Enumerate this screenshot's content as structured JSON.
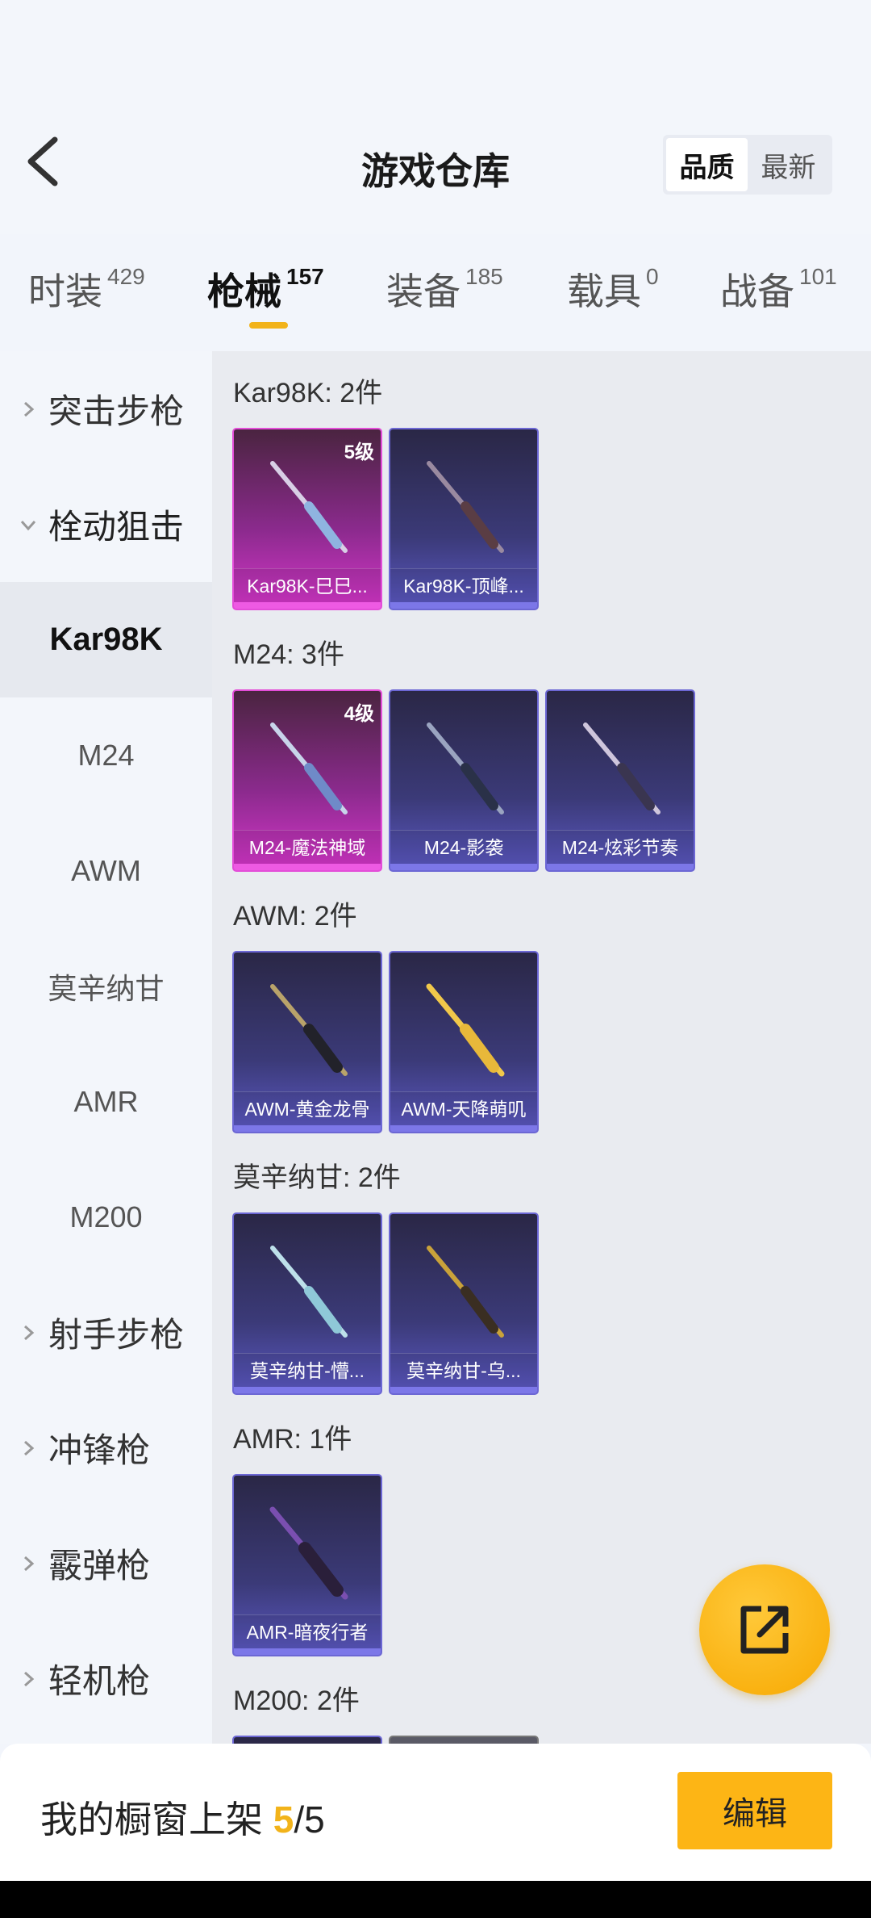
{
  "header": {
    "title": "游戏仓库",
    "sort": [
      {
        "label": "品质",
        "active": true
      },
      {
        "label": "最新",
        "active": false
      }
    ]
  },
  "tabs": [
    {
      "label": "时装",
      "count": "429",
      "active": false
    },
    {
      "label": "枪械",
      "count": "157",
      "active": true
    },
    {
      "label": "装备",
      "count": "185",
      "active": false
    },
    {
      "label": "载具",
      "count": "0",
      "active": false
    },
    {
      "label": "战备",
      "count": "101",
      "active": false
    }
  ],
  "sidebar": {
    "items": [
      {
        "label": "突击步枪",
        "type": "group",
        "expanded": false
      },
      {
        "label": "栓动狙击",
        "type": "group",
        "expanded": true
      },
      {
        "label": "Kar98K",
        "type": "sub",
        "active": true
      },
      {
        "label": "M24",
        "type": "sub",
        "active": false
      },
      {
        "label": "AWM",
        "type": "sub",
        "active": false
      },
      {
        "label": "莫辛纳甘",
        "type": "sub",
        "active": false
      },
      {
        "label": "AMR",
        "type": "sub",
        "active": false
      },
      {
        "label": "M200",
        "type": "sub",
        "active": false
      },
      {
        "label": "射手步枪",
        "type": "group",
        "expanded": false
      },
      {
        "label": "冲锋枪",
        "type": "group",
        "expanded": false
      },
      {
        "label": "霰弹枪",
        "type": "group",
        "expanded": false
      },
      {
        "label": "轻机枪",
        "type": "group",
        "expanded": false
      }
    ]
  },
  "sections": [
    {
      "title": "Kar98K: 2件",
      "items": [
        {
          "name": "Kar98K-巳巳...",
          "level": "5级",
          "quality": "pink"
        },
        {
          "name": "Kar98K-顶峰...",
          "level": "",
          "quality": "purple"
        }
      ]
    },
    {
      "title": "M24: 3件",
      "items": [
        {
          "name": "M24-魔法神域",
          "level": "4级",
          "quality": "pink"
        },
        {
          "name": "M24-影袭",
          "level": "",
          "quality": "purple"
        },
        {
          "name": "M24-炫彩节奏",
          "level": "",
          "quality": "purple"
        }
      ]
    },
    {
      "title": "AWM: 2件",
      "items": [
        {
          "name": "AWM-黄金龙骨",
          "level": "",
          "quality": "purple"
        },
        {
          "name": "AWM-天降萌叽",
          "level": "",
          "quality": "purple"
        }
      ]
    },
    {
      "title": "莫辛纳甘: 2件",
      "items": [
        {
          "name": "莫辛纳甘-懵...",
          "level": "",
          "quality": "purple"
        },
        {
          "name": "莫辛纳甘-乌...",
          "level": "",
          "quality": "purple"
        }
      ]
    },
    {
      "title": "AMR: 1件",
      "items": [
        {
          "name": "AMR-暗夜行者",
          "level": "",
          "quality": "purple"
        }
      ]
    },
    {
      "title": "M200: 2件",
      "items": [
        {
          "name": "",
          "level": "",
          "quality": "purple"
        },
        {
          "name": "",
          "level": "",
          "quality": "grey"
        }
      ]
    }
  ],
  "bottom": {
    "label": "我的橱窗上架",
    "current": "5",
    "separator": "/",
    "total": "5",
    "edit_label": "编辑"
  },
  "colors": {
    "accent": "#f2b31a",
    "edit_button": "#fdb515",
    "pink_quality": "#d436c9",
    "purple_quality": "#5b58c2"
  }
}
